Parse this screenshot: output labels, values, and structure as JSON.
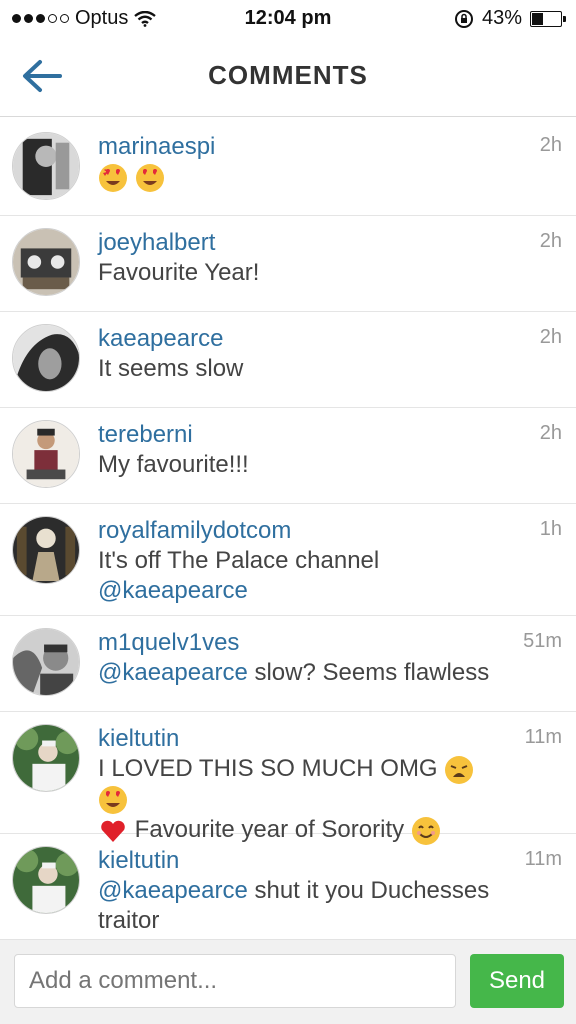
{
  "status_bar": {
    "carrier": "Optus",
    "time": "12:04 pm",
    "battery": "43%"
  },
  "nav": {
    "title": "COMMENTS"
  },
  "comments": [
    {
      "user": "marinaespi",
      "time": "2h",
      "text": "",
      "mention": "",
      "after": ""
    },
    {
      "user": "joeyhalbert",
      "time": "2h",
      "text": "Favourite Year!",
      "mention": "",
      "after": ""
    },
    {
      "user": "kaeapearce",
      "time": "2h",
      "text": "It seems slow",
      "mention": "",
      "after": ""
    },
    {
      "user": "tereberni",
      "time": "2h",
      "text": "My favourite!!!",
      "mention": "",
      "after": ""
    },
    {
      "user": "royalfamilydotcom",
      "time": "1h",
      "text": "It's off The Palace channel",
      "mention": "@kaeapearce",
      "after": ""
    },
    {
      "user": "m1quelv1ves",
      "time": "51m",
      "text": "",
      "mention": "@kaeapearce",
      "after": " slow? Seems flawless"
    },
    {
      "user": "kieltutin",
      "time": "11m",
      "text": "I LOVED THIS SO MUCH OMG",
      "mention": "",
      "after": "Favourite year of Sorority"
    },
    {
      "user": "kieltutin",
      "time": "11m",
      "text": "",
      "mention": "@kaeapearce",
      "after": " shut it you Duchesses traitor"
    }
  ],
  "composer": {
    "placeholder": "Add a comment...",
    "send_label": "Send"
  },
  "colors": {
    "link": "#2f6f9f",
    "send": "#45b74a"
  }
}
